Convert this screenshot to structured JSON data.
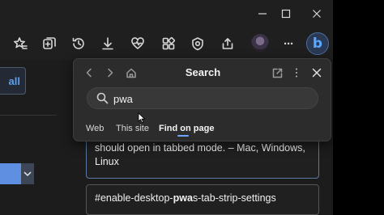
{
  "window": {
    "minimize": "—",
    "maximize": "☐",
    "close": "✕"
  },
  "toolbar": {
    "icons": [
      "favorites-star-icon",
      "add-to-collections-icon",
      "history-icon",
      "downloads-icon",
      "browser-essentials-icon",
      "extensions-icon",
      "performance-icon",
      "share-icon",
      "profile-avatar",
      "more-menu-icon",
      "copilot-bing-icon"
    ],
    "more_label": "···",
    "bing_label": "b"
  },
  "page": {
    "all_button": "all",
    "flag_description": "should open in tabbed mode. – Mac, Windows, Linux",
    "flag_name_prefix": "#enable-desktop-",
    "flag_name_match": "pwa",
    "flag_name_suffix": "s-tab-strip-settings"
  },
  "search_panel": {
    "title": "Search",
    "query": "pwa",
    "tabs": [
      {
        "label": "Web",
        "active": false
      },
      {
        "label": "This site",
        "active": false
      },
      {
        "label": "Find on page",
        "active": true
      }
    ],
    "accent": "#6aa7ff"
  }
}
